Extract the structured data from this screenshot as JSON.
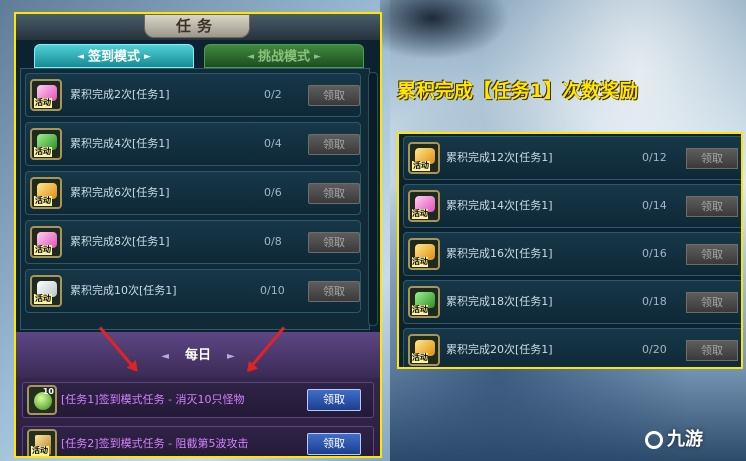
{
  "left_panel": {
    "title": "任务",
    "tabs": [
      {
        "label": "签到模式",
        "active": true
      },
      {
        "label": "挑战模式",
        "active": false
      }
    ],
    "tasks": [
      {
        "label": "累积完成2次[任务1]",
        "count": "0/2",
        "button": "领取",
        "icon": "pink-crystal-icon"
      },
      {
        "label": "累积完成4次[任务1]",
        "count": "0/4",
        "button": "领取",
        "icon": "green-potion-icon"
      },
      {
        "label": "累积完成6次[任务1]",
        "count": "0/6",
        "button": "领取",
        "icon": "gold-ingot-icon"
      },
      {
        "label": "累积完成8次[任务1]",
        "count": "0/8",
        "button": "领取",
        "icon": "pink-crystal-icon"
      },
      {
        "label": "累积完成10次[任务1]",
        "count": "0/10",
        "button": "领取",
        "icon": "scroll-icon"
      }
    ],
    "daily_title": "每日",
    "daily_tasks": [
      {
        "label": "[任务1]签到模式任务 - 消灭10只怪物",
        "button": "领取",
        "icon": "green-orb-icon",
        "badge": "10"
      },
      {
        "label": "[任务2]签到模式任务 - 阻截第5波攻击",
        "button": "领取",
        "icon": "sword-icon"
      }
    ],
    "icon_tag": "活动"
  },
  "right_panel": {
    "heading": "累积完成【任务1】次数奖励",
    "tasks": [
      {
        "label": "累积完成12次[任务1]",
        "count": "0/12",
        "button": "领取",
        "icon": "gold-ingot-icon"
      },
      {
        "label": "累积完成14次[任务1]",
        "count": "0/14",
        "button": "领取",
        "icon": "pink-crystal-icon"
      },
      {
        "label": "累积完成16次[任务1]",
        "count": "0/16",
        "button": "领取",
        "icon": "gold-ingot-icon"
      },
      {
        "label": "累积完成18次[任务1]",
        "count": "0/18",
        "button": "领取",
        "icon": "green-potion-icon"
      },
      {
        "label": "累积完成20次[任务1]",
        "count": "0/20",
        "button": "领取",
        "icon": "gold-ingot-icon"
      }
    ]
  },
  "watermark": "九游",
  "colors": {
    "highlight_border": "#ffe500",
    "heading": "#ffe500",
    "daily_task_text": "#d580ff",
    "arrow": "#e02424"
  }
}
